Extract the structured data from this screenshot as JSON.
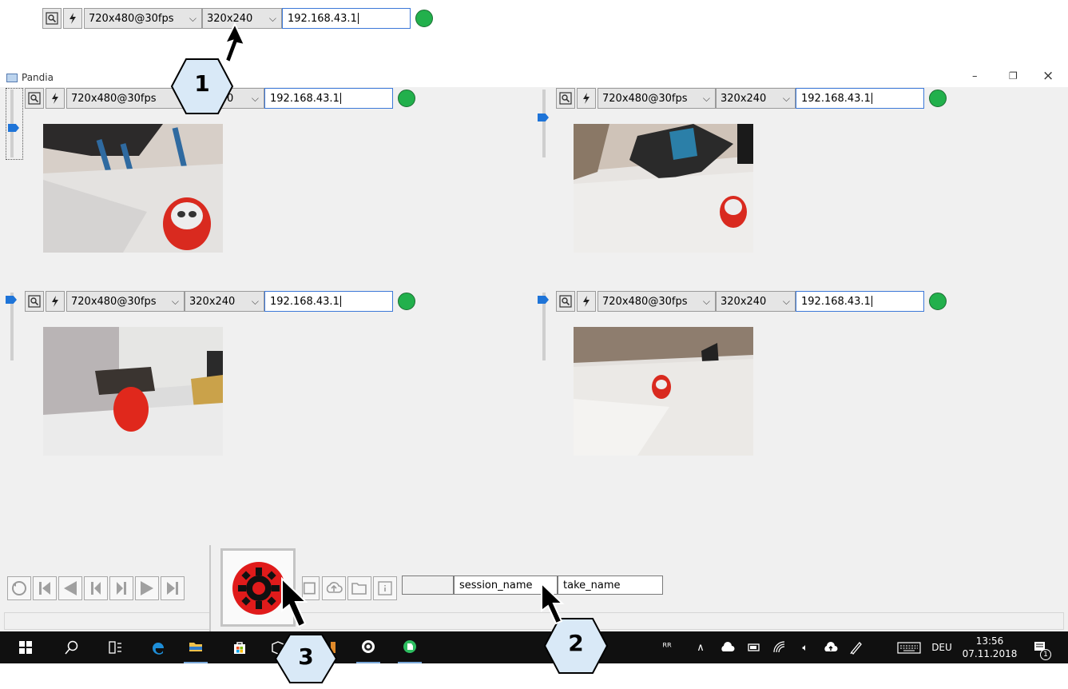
{
  "callouts": [
    "1",
    "2",
    "3"
  ],
  "camera_bar": {
    "zoom_icon": "magnifier-icon",
    "flash_icon": "lightning-icon",
    "resolution": "720x480@30fps",
    "preview_size": "320x240",
    "ip": "192.168.43.1",
    "status_color": "#22b04c"
  },
  "window": {
    "title": "Pandia",
    "controls": [
      "–",
      "❐",
      "×"
    ]
  },
  "cameras": [
    {
      "resolution": "720x480@30fps",
      "preview_size": "0",
      "ip": "192.168.43.1"
    },
    {
      "resolution": "720x480@30fps",
      "preview_size": "320x240",
      "ip": "192.168.43.1"
    },
    {
      "resolution": "720x480@30fps",
      "preview_size": "320x240",
      "ip": "192.168.43.1"
    },
    {
      "resolution": "720x480@30fps",
      "preview_size": "320x240",
      "ip": "192.168.43.1"
    }
  ],
  "playback": {
    "buttons": [
      "refresh-icon",
      "first-frame-icon",
      "back-icon",
      "prev-frame-icon",
      "next-frame-icon",
      "play-icon",
      "last-frame-icon",
      "record-icon",
      "save-icon",
      "upload-icon",
      "folder-icon",
      "info-icon"
    ],
    "session_name": "session_name",
    "take_name": "take_name"
  },
  "taskbar": {
    "language": "DEU",
    "time": "13:56",
    "date": "07.11.2018",
    "notification_count": "1"
  }
}
